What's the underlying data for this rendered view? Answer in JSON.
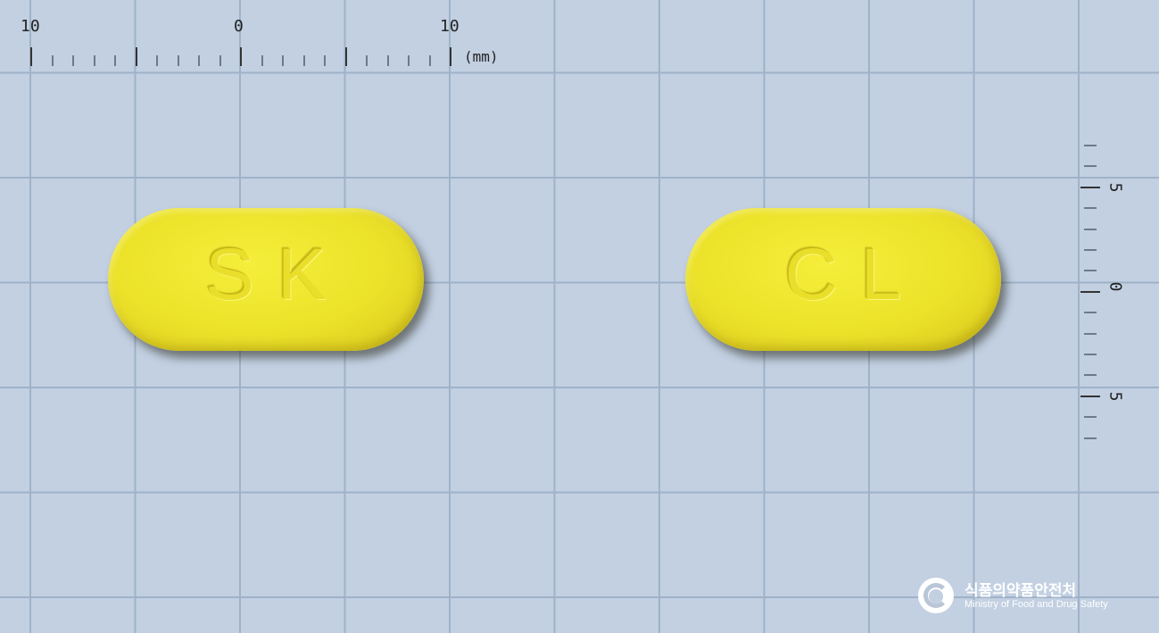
{
  "ruler_top": {
    "labels": [
      "10",
      "0",
      "10"
    ],
    "unit": "(mm)"
  },
  "ruler_right": {
    "labels": [
      "5",
      "0",
      "5"
    ]
  },
  "tablets": [
    {
      "imprint": "SK",
      "color": "#ece22a"
    },
    {
      "imprint": "CL",
      "color": "#ece22a"
    }
  ],
  "background_color": "#c2d0e2",
  "logo": {
    "icon": "mfds-swirl-icon",
    "korean": "식품의약품안전처",
    "english": "Ministry of Food and Drug Safety"
  }
}
